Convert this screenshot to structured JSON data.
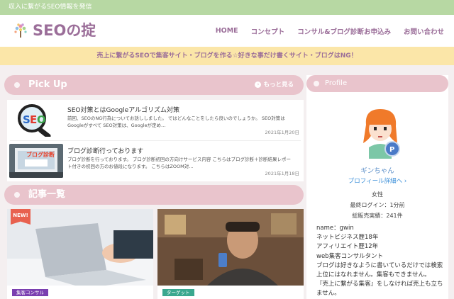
{
  "topbar": {
    "tagline": "収入に繋がるSEO情報を発信"
  },
  "header": {
    "site_title": "SEOの掟",
    "nav": [
      "HOME",
      "コンセプト",
      "コンサル&ブログ診断お申込み",
      "お問い合わせ"
    ]
  },
  "banner": {
    "text": "売上に繋がるSEOで集客サイト・ブログを作る☆好きな事だけ書くサイト・ブログはNG！"
  },
  "pickup": {
    "title": "Pick Up",
    "more": "もっと見る",
    "items": [
      {
        "title": "SEO対策とはGoogleアルゴリズム対策",
        "excerpt": "前回、SEOのNG行為についてお話ししました。 ではどんなことをしたら良いのでしょうか。 SEO対策はGoogleがすべて SEO対策は、Googleが定め…",
        "date": "2021年1月20日",
        "thumb_text": "SEO"
      },
      {
        "title": "ブログ診断行っております",
        "excerpt": "ブログ診断を行っております。 ブログ診断初回の方向けサービス内容 こちらはブログ診断＋診断結果レポート付きの初回の方のお値段になります。 こちらはZOOM対…",
        "date": "2021年1月18日",
        "thumb_text": "ブログ診断"
      }
    ]
  },
  "articles": {
    "title": "記事一覧",
    "new_badge": "NEW!",
    "cards": [
      {
        "tag": "集客コンサル",
        "tag_color": "#7a3fb0"
      },
      {
        "tag": "ターゲット",
        "tag_color": "#3aa88f"
      }
    ]
  },
  "profile": {
    "title": "Profile",
    "name": "ギンちゃん",
    "detail_link": "プロフィール詳細へ",
    "gender": "女性",
    "last_login": "最終ログイン：1分前",
    "sales": "総販売実績：241件",
    "bio": [
      "name：gwin",
      "ネットビジネス歴18年",
      "アフィリエイト歴12年",
      "web集客コンサルタント",
      "ブログは好きなように書いているだけでは検索上位にはなれません。集客もできません。",
      "『売上に繋がる集客』をしなければ売上も立ちません。"
    ]
  },
  "colors": {
    "accent": "#9b6e99",
    "section": "#e9c4cc",
    "topbar": "#b7d8a3",
    "banner": "#fbe6a8"
  }
}
